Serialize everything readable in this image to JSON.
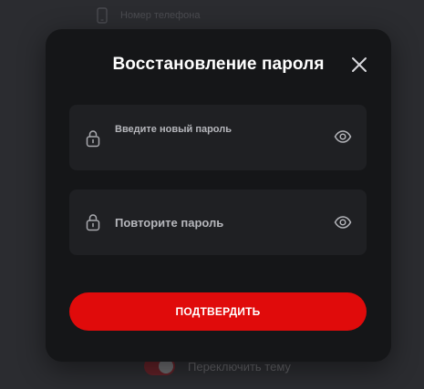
{
  "background": {
    "phone_label": "Номер телефона",
    "theme_label": "Переключить тему"
  },
  "modal": {
    "title": "Восстановление пароля",
    "new_password": {
      "label": "Введите новый пароль",
      "value": ""
    },
    "repeat_password": {
      "placeholder": "Повторите пароль",
      "value": ""
    },
    "submit_label": "ПОДТВЕРДИТЬ"
  },
  "colors": {
    "accent": "#e00b0b",
    "modal_bg": "#151618",
    "field_bg": "#1f2023",
    "backdrop": "#2b2c30"
  },
  "icons": {
    "close": "close-icon",
    "lock": "lock-icon",
    "eye": "eye-icon",
    "phone": "phone-icon"
  }
}
